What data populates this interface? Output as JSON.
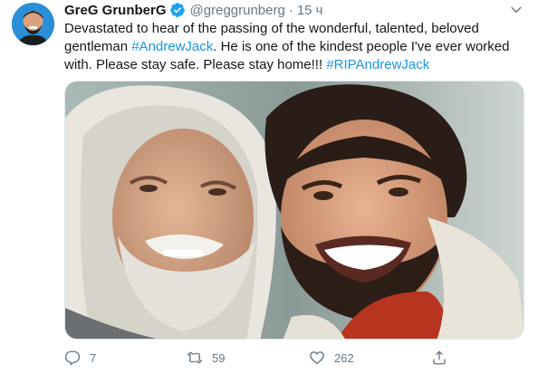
{
  "tweet": {
    "author_name": "GreG GrunberG",
    "handle": "@greggrunberg",
    "separator": "·",
    "time": "15 ч",
    "text_part1": "Devastated to hear of the passing of the wonderful, talented, beloved gentleman ",
    "hashtag1": "#AndrewJack",
    "text_part2": ". He is one of the kindest people I've ever worked with. Please stay safe.  Please stay home!!! ",
    "hashtag2": "#RIPAndrewJack"
  },
  "actions": {
    "reply_count": "7",
    "retweet_count": "59",
    "like_count": "262"
  },
  "icons": {
    "verified": "verified-badge-icon",
    "caret": "chevron-down-icon",
    "reply": "reply-icon",
    "retweet": "retweet-icon",
    "like": "heart-icon",
    "share": "share-icon"
  },
  "colors": {
    "link": "#1b95e0",
    "verified": "#1da1f2",
    "secondary_text": "#657786"
  }
}
